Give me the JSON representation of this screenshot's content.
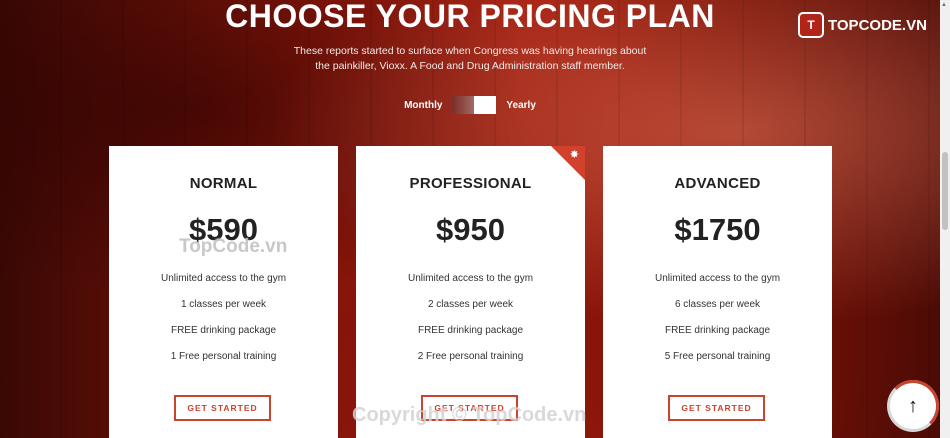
{
  "section": {
    "title": "CHOOSE YOUR PRICING PLAN",
    "subtitle": "These reports started to surface when Congress was having hearings about the painkiller, Vioxx. A Food and Drug Administration staff member."
  },
  "billing_toggle": {
    "monthly_label": "Monthly",
    "yearly_label": "Yearly"
  },
  "plans": [
    {
      "name": "NORMAL",
      "price": "$590",
      "features": [
        "Unlimited access to the gym",
        "1 classes per week",
        "FREE drinking package",
        "1 Free personal training"
      ],
      "button_label": "GET STARTED"
    },
    {
      "name": "PROFESSIONAL",
      "price": "$950",
      "features": [
        "Unlimited access to the gym",
        "2 classes per week",
        "FREE drinking package",
        "2 Free personal training"
      ],
      "button_label": "GET STARTED",
      "featured": true
    },
    {
      "name": "ADVANCED",
      "price": "$1750",
      "features": [
        "Unlimited access to the gym",
        "6 classes per week",
        "FREE drinking package",
        "5 Free personal training"
      ],
      "button_label": "GET STARTED"
    }
  ],
  "logo": {
    "icon_text": "T",
    "text": "TOPCODE.VN"
  },
  "watermarks": {
    "center": "TopCode.vn",
    "footer": "Copyright © TopCode.vn"
  },
  "colors": {
    "accent": "#c9442c",
    "ribbon": "#d2412b"
  },
  "icons": {
    "featured_ribbon": "star-icon",
    "back_to_top": "arrow-up-icon"
  }
}
